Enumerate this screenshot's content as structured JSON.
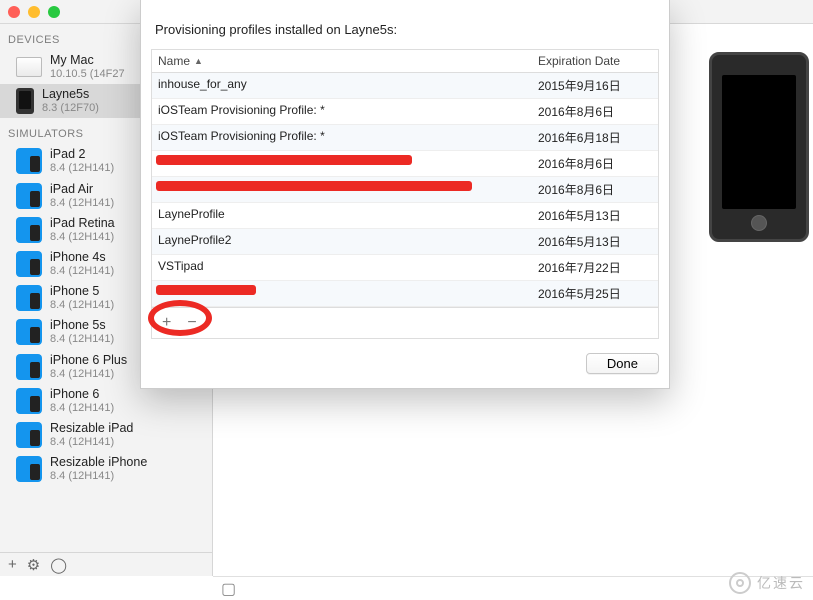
{
  "sidebar": {
    "devices_header": "DEVICES",
    "simulators_header": "SIMULATORS",
    "devices": [
      {
        "name": "My Mac",
        "sub": "10.10.5 (14F27",
        "icon": "mac",
        "selected": false
      },
      {
        "name": "Layne5s",
        "sub": "8.3 (12F70)",
        "icon": "phone",
        "selected": true
      }
    ],
    "simulators": [
      {
        "name": "iPad 2",
        "sub": "8.4 (12H141)"
      },
      {
        "name": "iPad Air",
        "sub": "8.4 (12H141)"
      },
      {
        "name": "iPad Retina",
        "sub": "8.4 (12H141)"
      },
      {
        "name": "iPhone 4s",
        "sub": "8.4 (12H141)"
      },
      {
        "name": "iPhone 5",
        "sub": "8.4 (12H141)"
      },
      {
        "name": "iPhone 5s",
        "sub": "8.4 (12H141)"
      },
      {
        "name": "iPhone 6 Plus",
        "sub": "8.4 (12H141)"
      },
      {
        "name": "iPhone 6",
        "sub": "8.4 (12H141)"
      },
      {
        "name": "Resizable iPad",
        "sub": "8.4 (12H141)"
      },
      {
        "name": "Resizable iPhone",
        "sub": "8.4 (12H141)"
      }
    ],
    "bottom": {
      "add": "+",
      "gear": "⚙",
      "filter": "◯"
    }
  },
  "detail_toolbar": {
    "add": "+",
    "remove": "−",
    "sep": "|",
    "gear": "⚙",
    "panel": "▢"
  },
  "sheet": {
    "title": "Provisioning profiles installed on Layne5s:",
    "columns": {
      "name": "Name",
      "date": "Expiration Date"
    },
    "rows": [
      {
        "name": "inhouse_for_any",
        "date": "2015年9月16日",
        "redact": ""
      },
      {
        "name": "iOSTeam Provisioning Profile: *",
        "date": "2016年8月6日",
        "redact": ""
      },
      {
        "name": "iOSTeam Provisioning Profile: *",
        "date": "2016年6月18日",
        "redact": ""
      },
      {
        "name": " ",
        "date": "2016年8月6日",
        "redact": "1"
      },
      {
        "name": " ",
        "date": "2016年8月6日",
        "redact": "2"
      },
      {
        "name": "LayneProfile",
        "date": "2016年5月13日",
        "redact": ""
      },
      {
        "name": "LayneProfile2",
        "date": "2016年5月13日",
        "redact": ""
      },
      {
        "name": "VSTipad",
        "date": "2016年7月22日",
        "redact": ""
      },
      {
        "name": " ",
        "date": "2016年5月25日",
        "redact": "3"
      }
    ],
    "footer": {
      "add": "+",
      "remove": "−"
    },
    "done": "Done"
  },
  "watermark": "亿速云"
}
